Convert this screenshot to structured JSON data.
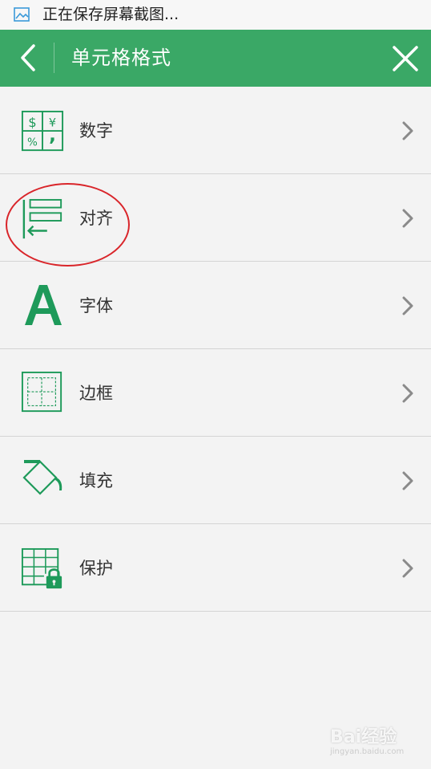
{
  "status_bar": {
    "text": "正在保存屏幕截图..."
  },
  "header": {
    "title": "单元格格式"
  },
  "menu": {
    "items": [
      {
        "label": "数字",
        "icon": "number-format-icon"
      },
      {
        "label": "对齐",
        "icon": "alignment-icon"
      },
      {
        "label": "字体",
        "icon": "font-icon"
      },
      {
        "label": "边框",
        "icon": "border-icon"
      },
      {
        "label": "填充",
        "icon": "fill-bucket-icon"
      },
      {
        "label": "保护",
        "icon": "protection-lock-icon"
      }
    ],
    "number_icon_symbols": [
      "$",
      "¥",
      "%",
      ","
    ]
  },
  "colors": {
    "accent": "#3aa866",
    "icon_green": "#1e9a5a",
    "annotation_red": "#d9252a"
  },
  "watermark": {
    "brand": "Bai经验",
    "url": "jingyan.baidu.com"
  }
}
